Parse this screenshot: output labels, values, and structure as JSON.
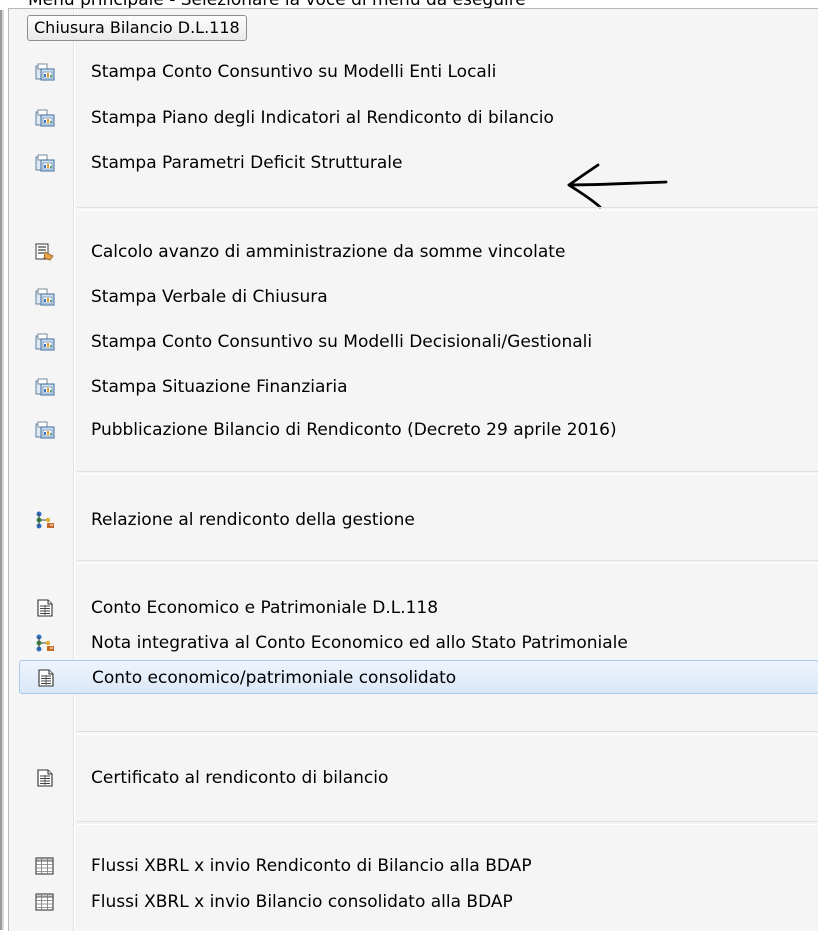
{
  "window": {
    "clipped_title": "Menu principale - Selezionare la voce di menu da eseguire"
  },
  "menu": {
    "title": "Chiusura Bilancio D.L.118",
    "items": [
      {
        "label": "Stampa Conto Consuntivo su Modelli Enti Locali",
        "icon": "print-report-icon"
      },
      {
        "label": "Stampa Piano degli Indicatori al Rendiconto di bilancio",
        "icon": "print-report-icon"
      },
      {
        "label": "Stampa Parametri Deficit Strutturale",
        "icon": "print-report-icon"
      },
      {
        "label": "Calcolo avanzo di amministrazione da somme vincolate",
        "icon": "calculate-icon"
      },
      {
        "label": "Stampa Verbale di Chiusura",
        "icon": "print-report-icon"
      },
      {
        "label": "Stampa Conto Consuntivo su Modelli Decisionali/Gestionali",
        "icon": "print-report-icon"
      },
      {
        "label": "Stampa Situazione Finanziaria",
        "icon": "print-report-icon"
      },
      {
        "label": "Pubblicazione Bilancio di Rendiconto (Decreto 29 aprile 2016)",
        "icon": "print-report-icon"
      },
      {
        "label": "Relazione al rendiconto della gestione",
        "icon": "workflow-icon"
      },
      {
        "label": "Conto Economico e Patrimoniale D.L.118",
        "icon": "document-icon"
      },
      {
        "label": "Nota integrativa al Conto Economico ed allo Stato Patrimoniale",
        "icon": "workflow-icon"
      },
      {
        "label": "Conto economico/patrimoniale consolidato",
        "icon": "document-icon",
        "selected": true
      },
      {
        "label": "Certificato al rendiconto di bilancio",
        "icon": "document-icon"
      },
      {
        "label": "Flussi XBRL x invio Rendiconto di Bilancio alla BDAP",
        "icon": "grid-table-icon"
      },
      {
        "label": "Flussi XBRL x invio Bilancio consolidato alla BDAP",
        "icon": "grid-table-icon"
      }
    ]
  },
  "colors": {
    "menu_bg": "#f5f5f5",
    "selection_bg": "#dbe8f8",
    "selection_border": "#a8c8ee",
    "arrow_ink": "#000000"
  }
}
